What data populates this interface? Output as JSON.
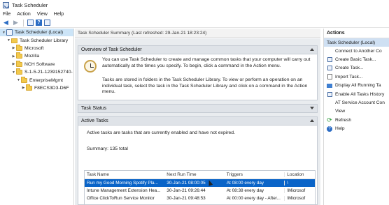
{
  "window": {
    "title": "Task Scheduler"
  },
  "menu": [
    "File",
    "Action",
    "View",
    "Help"
  ],
  "toolbar": {
    "back": "◀",
    "forward": "▶",
    "help": "?"
  },
  "tree": {
    "items": [
      {
        "label": "Task Scheduler (Local)",
        "level": 0,
        "expanded": true,
        "selected": true,
        "icon": "scheduler-icon"
      },
      {
        "label": "Task Scheduler Library",
        "level": 1,
        "expanded": true,
        "selected": false,
        "icon": "library-icon"
      },
      {
        "label": "Microsoft",
        "level": 2,
        "expanded": false,
        "selected": false,
        "icon": "folder-icon"
      },
      {
        "label": "Mozilla",
        "level": 2,
        "expanded": false,
        "selected": false,
        "icon": "folder-icon"
      },
      {
        "label": "NCH Software",
        "level": 2,
        "expanded": false,
        "selected": false,
        "icon": "folder-icon"
      },
      {
        "label": "S-1-5-21-1239152740-",
        "level": 2,
        "expanded": true,
        "selected": false,
        "icon": "folder-icon"
      },
      {
        "label": "EnterpriseMgmt",
        "level": 3,
        "expanded": true,
        "selected": false,
        "icon": "folder-icon"
      },
      {
        "label": "F8ECS3D3-D6F",
        "level": 4,
        "expanded": false,
        "selected": false,
        "icon": "folder-icon"
      }
    ]
  },
  "center": {
    "header": "Task Scheduler Summary (Last refreshed: 29-Jan-21 18:23:24)",
    "overview": {
      "title": "Overview of Task Scheduler",
      "para1": "You can use Task Scheduler to create and manage common tasks that your computer will carry out automatically at the times you specify. To begin, click a command in the Action menu.",
      "para2": "Tasks are stored in folders in the Task Scheduler Library. To view or perform an operation on an individual task, select the task in the Task Scheduler Library and click on a command in the Action menu."
    },
    "task_status": {
      "title": "Task Status"
    },
    "active_tasks": {
      "title": "Active Tasks",
      "description": "Active tasks are tasks that are currently enabled and have not expired.",
      "summary": "Summary: 135 total",
      "columns": [
        "Task Name",
        "Next Run Time",
        "Triggers",
        "Location"
      ],
      "rows": [
        {
          "name": "Run my Good Morning Spotify Pla...",
          "next": "30-Jan-21 08:00:05",
          "triggers": "At 08:00 every day",
          "location": "\\",
          "selected": true
        },
        {
          "name": "Intune Management Extension Hea...",
          "next": "30-Jan-21 09:26:44",
          "triggers": "At 08:38 every day",
          "location": "\\Microsof",
          "selected": false
        },
        {
          "name": "Office ClickToRun Service Monitor",
          "next": "30-Jan-21 09:48:53",
          "triggers": "At 00:00 every day - After...",
          "location": "\\Microsof",
          "selected": false
        }
      ]
    }
  },
  "actions": {
    "title": "Actions",
    "subtitle": "Task Scheduler (Local)",
    "items": [
      {
        "label": "Connect to Another Co",
        "icon": "blank"
      },
      {
        "label": "Create Basic Task...",
        "icon": "create-basic-task-icon"
      },
      {
        "label": "Create Task...",
        "icon": "create-task-icon"
      },
      {
        "label": "Import Task...",
        "icon": "import-icon"
      },
      {
        "label": "Display All Running Ta",
        "icon": "display-running-icon"
      },
      {
        "label": "Enable All Tasks History",
        "icon": "history-icon"
      },
      {
        "label": "AT Service Account Con",
        "icon": "blank"
      },
      {
        "label": "View",
        "icon": "blank"
      },
      {
        "label": "Refresh",
        "icon": "refresh-icon"
      },
      {
        "label": "Help",
        "icon": "help-icon"
      }
    ]
  }
}
